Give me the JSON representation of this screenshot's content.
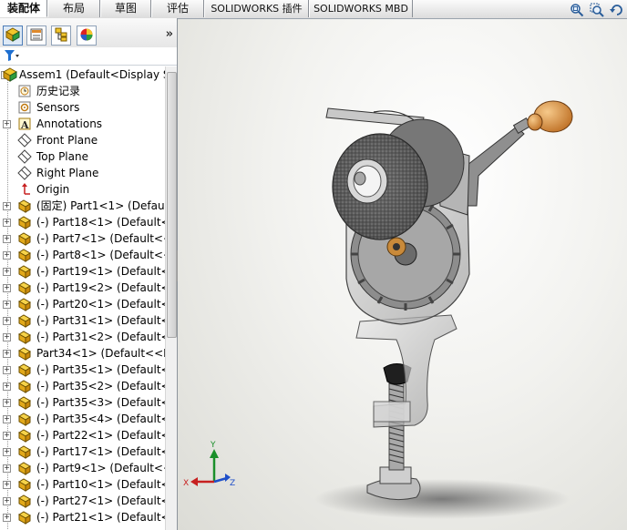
{
  "tabs": [
    "装配体",
    "布局",
    "草图",
    "评估",
    "SOLIDWORKS 插件",
    "SOLIDWORKS MBD"
  ],
  "active_tab": "装配体",
  "panel": {
    "collapse_label": "»",
    "tree": [
      {
        "label": "Assem1  (Default<Display S",
        "icon": "assembly-icon",
        "expand": "-",
        "indent": 0
      },
      {
        "label": "历史记录",
        "icon": "history-icon",
        "expand": "",
        "indent": 1
      },
      {
        "label": "Sensors",
        "icon": "sensor-icon",
        "expand": "",
        "indent": 1
      },
      {
        "label": "Annotations",
        "icon": "annotation-icon",
        "expand": "+",
        "indent": 1
      },
      {
        "label": "Front Plane",
        "icon": "plane-icon",
        "expand": "",
        "indent": 1
      },
      {
        "label": "Top Plane",
        "icon": "plane-icon",
        "expand": "",
        "indent": 1
      },
      {
        "label": "Right Plane",
        "icon": "plane-icon",
        "expand": "",
        "indent": 1
      },
      {
        "label": "Origin",
        "icon": "origin-icon",
        "expand": "",
        "indent": 1
      },
      {
        "label": "(固定) Part1<1> (Default",
        "icon": "part-icon",
        "expand": "+",
        "indent": 1
      },
      {
        "label": "(-) Part18<1> (Default<",
        "icon": "part-icon",
        "expand": "+",
        "indent": 1
      },
      {
        "label": "(-) Part7<1> (Default<<",
        "icon": "part-icon",
        "expand": "+",
        "indent": 1
      },
      {
        "label": "(-) Part8<1> (Default<<",
        "icon": "part-icon",
        "expand": "+",
        "indent": 1
      },
      {
        "label": "(-) Part19<1> (Default<",
        "icon": "part-icon",
        "expand": "+",
        "indent": 1
      },
      {
        "label": "(-) Part19<2> (Default<",
        "icon": "part-icon",
        "expand": "+",
        "indent": 1
      },
      {
        "label": "(-) Part20<1> (Default<",
        "icon": "part-icon",
        "expand": "+",
        "indent": 1
      },
      {
        "label": "(-) Part31<1> (Default<",
        "icon": "part-icon",
        "expand": "+",
        "indent": 1
      },
      {
        "label": "(-) Part31<2> (Default<",
        "icon": "part-icon",
        "expand": "+",
        "indent": 1
      },
      {
        "label": "Part34<1> (Default<<D",
        "icon": "part-icon",
        "expand": "+",
        "indent": 1
      },
      {
        "label": "(-) Part35<1> (Default<",
        "icon": "part-icon",
        "expand": "+",
        "indent": 1
      },
      {
        "label": "(-) Part35<2> (Default<",
        "icon": "part-icon",
        "expand": "+",
        "indent": 1
      },
      {
        "label": "(-) Part35<3> (Default<",
        "icon": "part-icon",
        "expand": "+",
        "indent": 1
      },
      {
        "label": "(-) Part35<4> (Default<",
        "icon": "part-icon",
        "expand": "+",
        "indent": 1
      },
      {
        "label": "(-) Part22<1> (Default<",
        "icon": "part-icon",
        "expand": "+",
        "indent": 1
      },
      {
        "label": "(-) Part17<1> (Default<",
        "icon": "part-icon",
        "expand": "+",
        "indent": 1
      },
      {
        "label": "(-) Part9<1> (Default<<",
        "icon": "part-icon",
        "expand": "+",
        "indent": 1
      },
      {
        "label": "(-) Part10<1> (Default<",
        "icon": "part-icon",
        "expand": "+",
        "indent": 1
      },
      {
        "label": "(-) Part27<1> (Default<",
        "icon": "part-icon",
        "expand": "+",
        "indent": 1
      },
      {
        "label": "(-) Part21<1> (Default<",
        "icon": "part-icon",
        "expand": "+",
        "indent": 1
      }
    ]
  },
  "triad": {
    "x": "X",
    "y": "Y",
    "z": "Z"
  },
  "colors": {
    "accent": "#1e6fd0",
    "tab_border": "#8a8f96",
    "part_yellow": "#f2c62b"
  }
}
